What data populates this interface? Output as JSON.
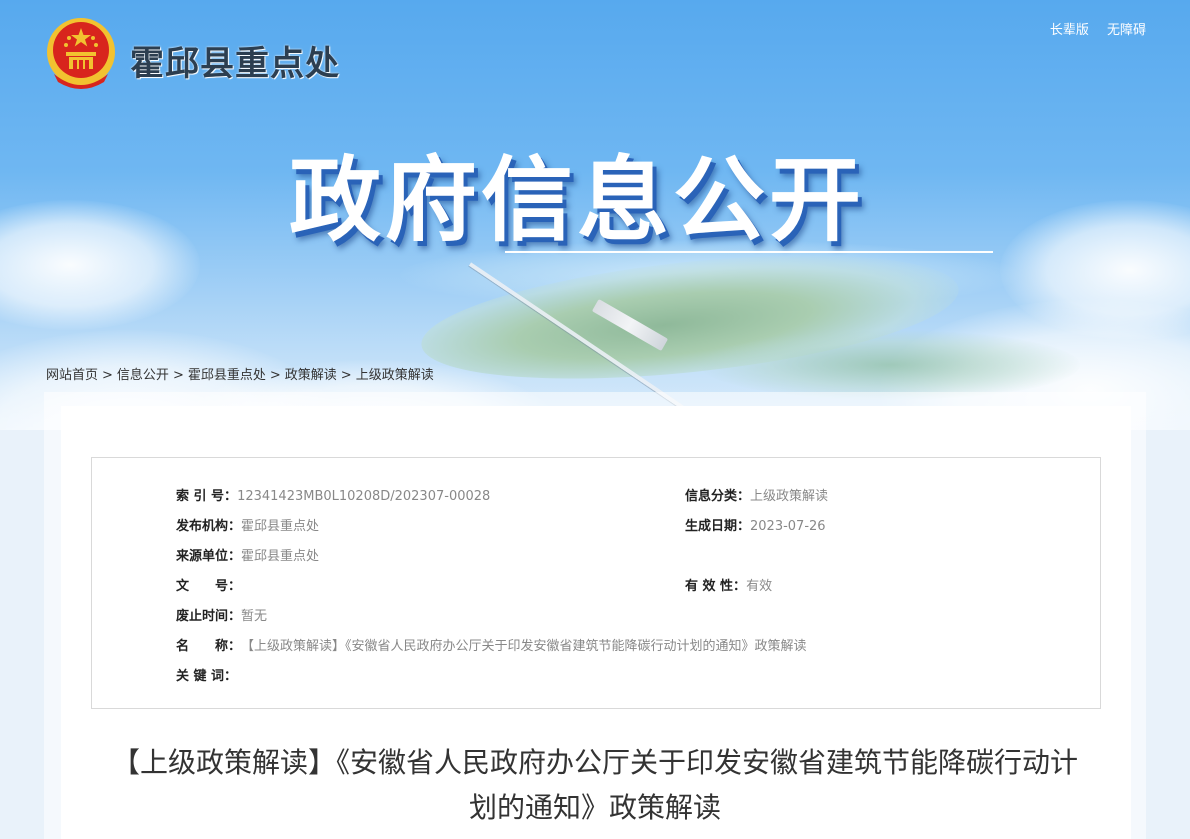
{
  "header": {
    "site_name": "霍邱县重点处",
    "links": [
      "长辈版",
      "无障碍"
    ]
  },
  "hero": {
    "title": "政府信息公开"
  },
  "breadcrumb": [
    "网站首页",
    "信息公开",
    "霍邱县重点处",
    "政策解读",
    "上级政策解读"
  ],
  "meta": {
    "index_label": "索 引 号：",
    "index_value": "12341423MB0L10208D/202307-00028",
    "category_label": "信息分类：",
    "category_value": "上级政策解读",
    "publisher_label": "发布机构：",
    "publisher_value": "霍邱县重点处",
    "date_label": "生成日期：",
    "date_value": "2023-07-26",
    "source_label": "来源单位：",
    "source_value": "霍邱县重点处",
    "docno_label": "文　　号：",
    "docno_value": "",
    "validity_label": "有 效 性：",
    "validity_value": "有效",
    "abolish_label": "废止时间：",
    "abolish_value": "暂无",
    "name_label": "名　　称：",
    "name_value": "【上级政策解读】《安徽省人民政府办公厅关于印发安徽省建筑节能降碳行动计划的通知》政策解读",
    "keywords_label": "关 键 词：",
    "keywords_value": ""
  },
  "article": {
    "title": "【上级政策解读】《安徽省人民政府办公厅关于印发安徽省建筑节能降碳行动计划的通知》政策解读"
  },
  "colors": {
    "sky": "#57a9ee",
    "title_shadow": "#2a63b8",
    "emblem_red": "#d8251d",
    "emblem_gold": "#f2c230"
  }
}
